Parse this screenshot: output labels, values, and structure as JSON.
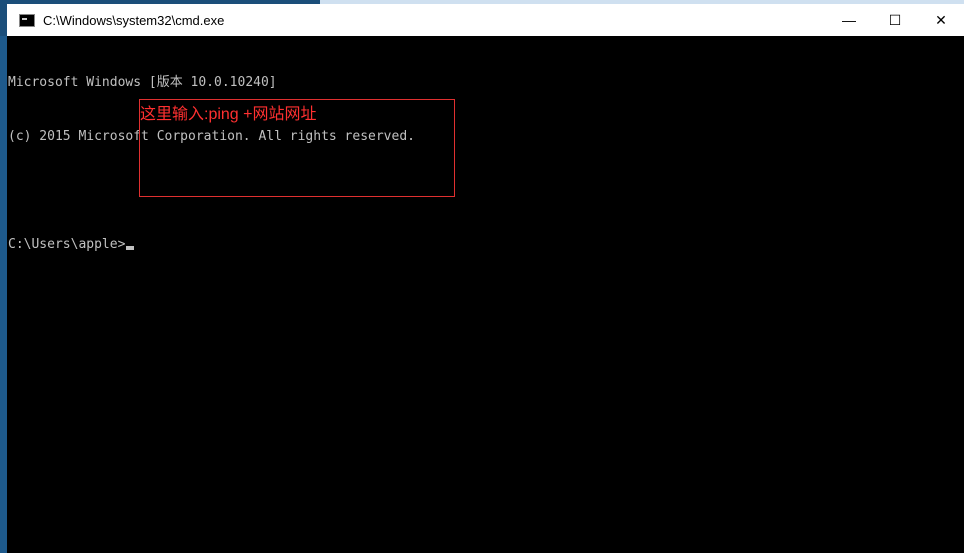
{
  "window": {
    "title": "C:\\Windows\\system32\\cmd.exe",
    "icon": "cmd-icon",
    "controls": {
      "minimize": "—",
      "maximize": "☐",
      "close": "✕"
    }
  },
  "console": {
    "lines": [
      "Microsoft Windows [版本 10.0.10240]",
      "(c) 2015 Microsoft Corporation. All rights reserved.",
      ""
    ],
    "prompt": "C:\\Users\\apple>"
  },
  "annotation": {
    "text": "这里输入:ping +网站网址",
    "color": "#ff3030"
  }
}
